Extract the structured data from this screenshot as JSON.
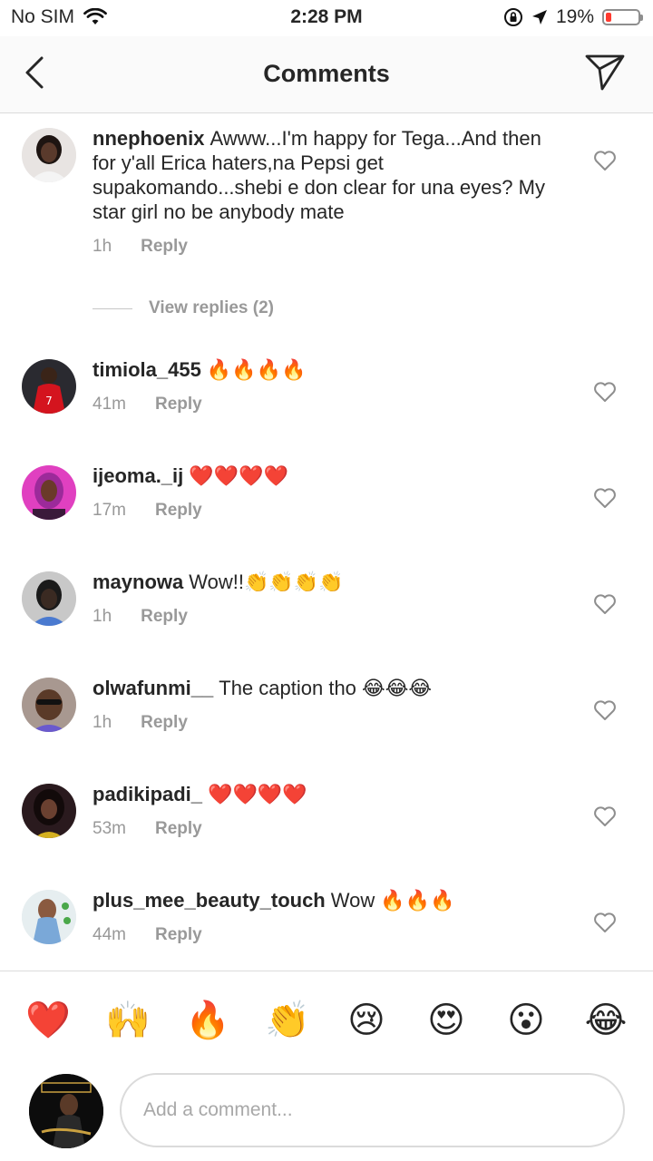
{
  "status": {
    "carrier": "No SIM",
    "time": "2:28 PM",
    "battery": "19%",
    "battery_level": 0.19,
    "battery_color": "#ff3b30"
  },
  "header": {
    "title": "Comments",
    "back_icon": "chevron-left-icon",
    "send_icon": "paper-plane-icon"
  },
  "comments": [
    {
      "user": "nnephoenix",
      "text": "Awww...I'm happy for Tega...And then for y'all Erica haters,na Pepsi get supakomando...shebi e don clear for una eyes? My star girl no be anybody mate",
      "time": "1h",
      "reply": "Reply"
    },
    {
      "user": "timiola_455",
      "text": "🔥🔥🔥🔥",
      "time": "41m",
      "reply": "Reply"
    },
    {
      "user": "ijeoma._ij",
      "text": "❤️❤️❤️❤️",
      "time": "17m",
      "reply": "Reply"
    },
    {
      "user": "maynowa",
      "text": "Wow!!👏👏👏👏",
      "time": "1h",
      "reply": "Reply"
    },
    {
      "user": "olwafunmi__",
      "text": "The caption tho 😂😂😂",
      "time": "1h",
      "reply": "Reply"
    },
    {
      "user": "padikipadi_",
      "text": "❤️❤️❤️❤️",
      "time": "53m",
      "reply": "Reply"
    },
    {
      "user": "plus_mee_beauty_touch",
      "text": "Wow 🔥🔥🔥",
      "time": "44m",
      "reply": "Reply"
    }
  ],
  "view_replies": "View replies (2)",
  "emoji_bar": [
    "❤️",
    "🙌",
    "🔥",
    "👏",
    "😢",
    "😍",
    "😮",
    "😂"
  ],
  "input": {
    "placeholder": "Add a comment..."
  }
}
